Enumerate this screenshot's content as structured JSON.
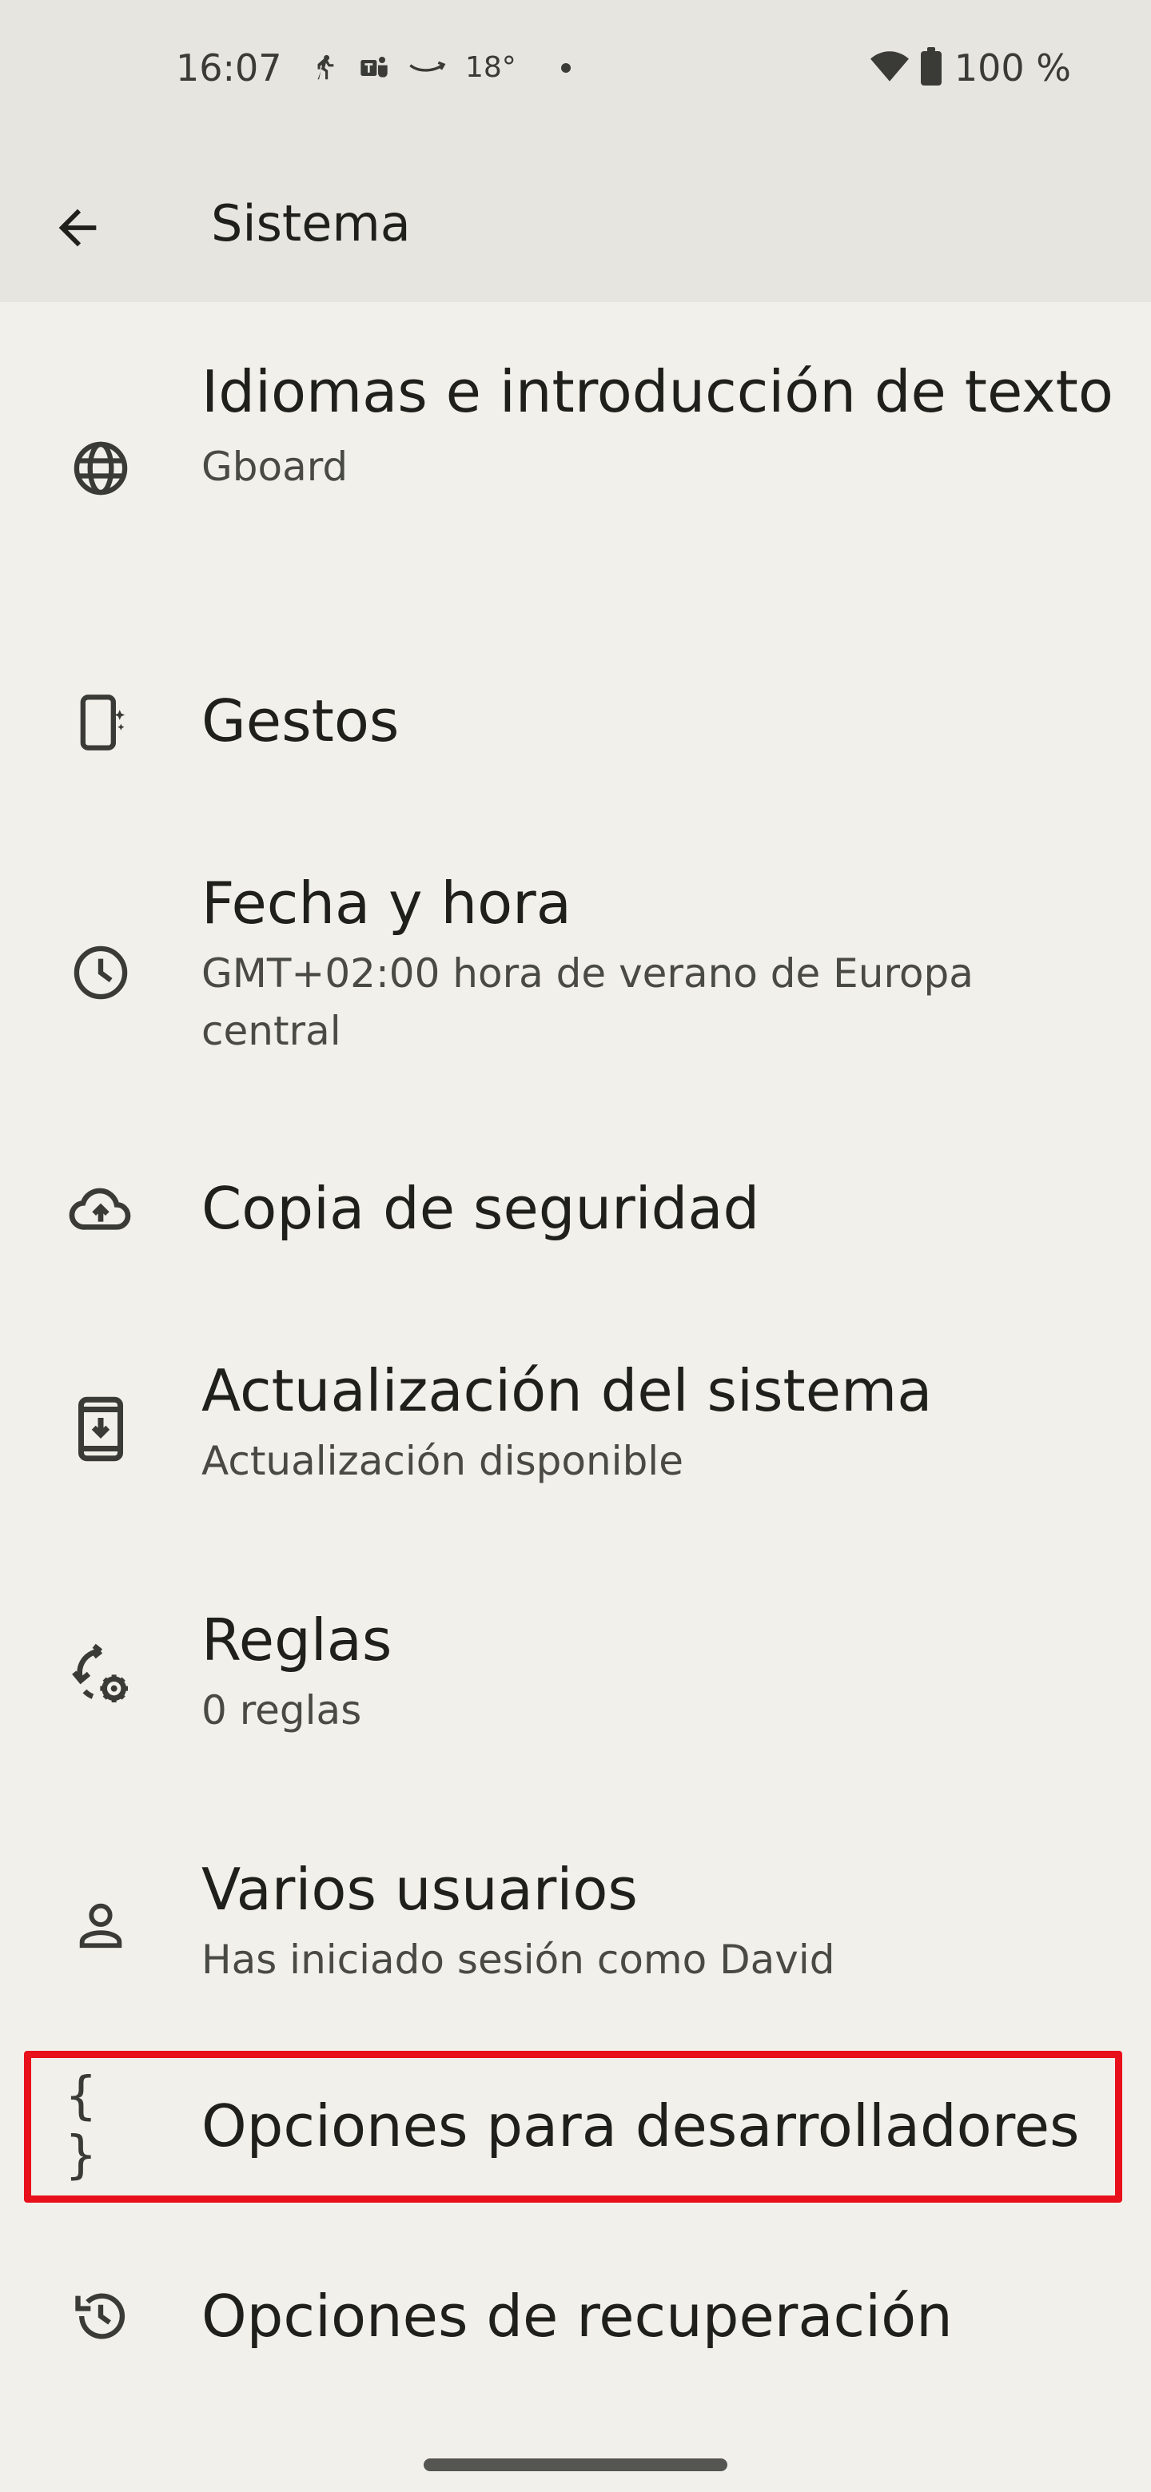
{
  "status_bar": {
    "time": "16:07",
    "temperature": "18°",
    "battery": "100 %",
    "icons": [
      "run-notification-icon",
      "teams-icon",
      "amazon-icon",
      "weather-temp",
      "more-dot-icon",
      "wifi-icon",
      "battery-icon"
    ]
  },
  "app_bar": {
    "title": "Sistema",
    "back_icon": "arrow-back-icon"
  },
  "settings_items": [
    {
      "label": "Idiomas e introducción de texto",
      "sub": "Gboard",
      "icon": "globe-icon"
    },
    {
      "label": "Gestos",
      "sub": "",
      "icon": "gestures-phone-icon"
    },
    {
      "label": "Fecha y hora",
      "sub": "GMT+02:00 hora de verano de Europa central",
      "icon": "clock-icon"
    },
    {
      "label": "Copia de seguridad",
      "sub": "",
      "icon": "cloud-upload-icon"
    },
    {
      "label": "Actualización del sistema",
      "sub": "Actualización disponible",
      "icon": "system-update-icon"
    },
    {
      "label": "Reglas",
      "sub": "0 reglas",
      "icon": "rules-sync-gear-icon"
    },
    {
      "label": "Varios usuarios",
      "sub": "Has iniciado sesión como David",
      "icon": "person-icon"
    },
    {
      "label": "Opciones para desarrolladores",
      "sub": "",
      "icon": "braces-icon",
      "highlighted": true
    },
    {
      "label": "Opciones de recuperación",
      "sub": "",
      "icon": "history-restore-icon"
    }
  ],
  "colors": {
    "background": "#f1f0ea",
    "top_bar": "#e6e5df",
    "highlight_border": "#e8101b"
  }
}
